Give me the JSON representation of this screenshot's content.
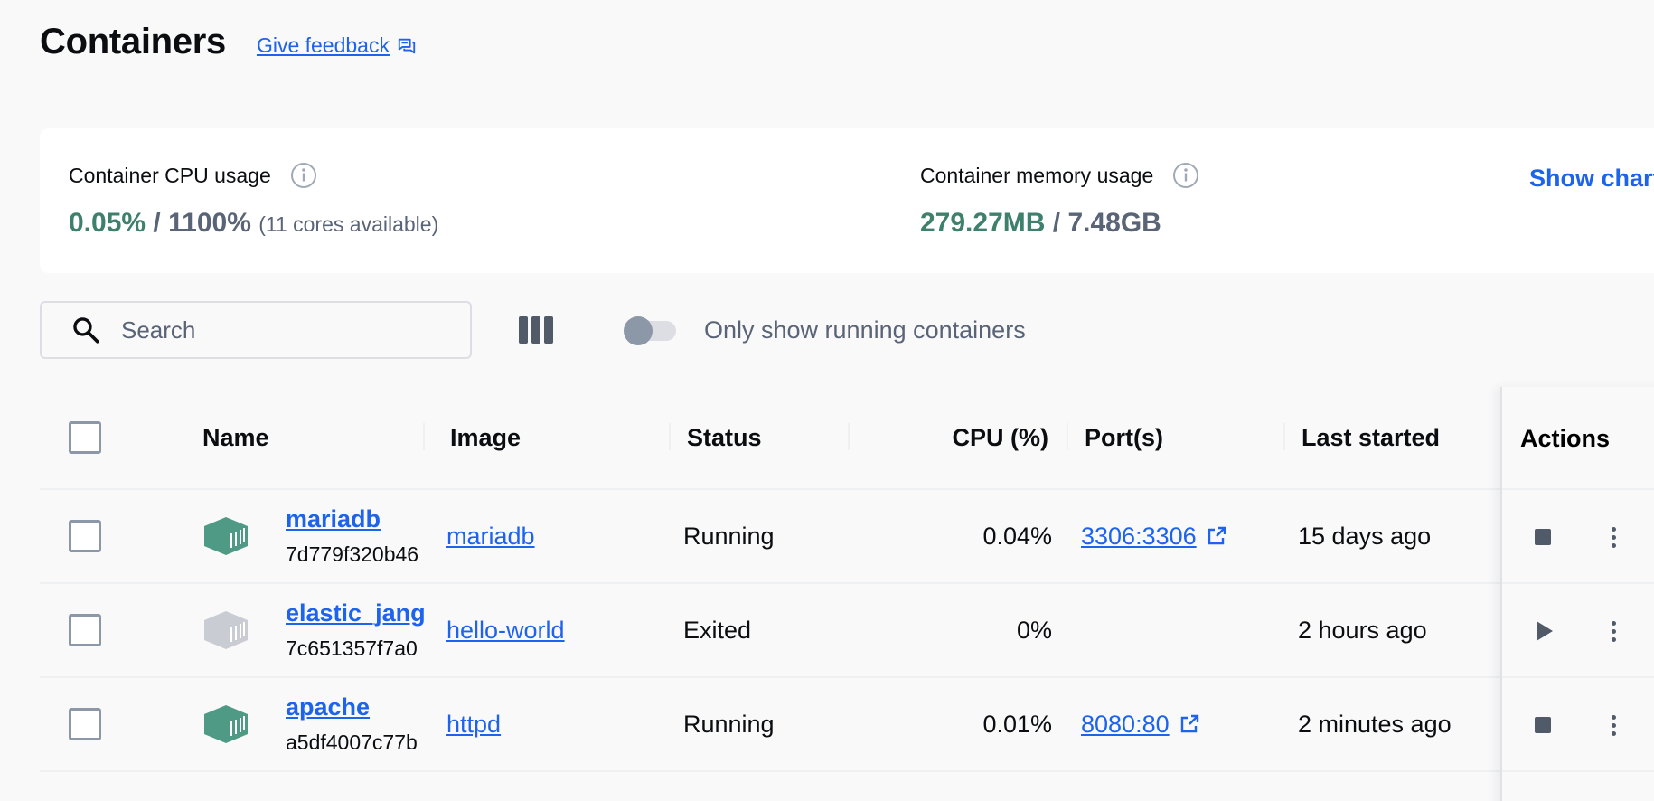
{
  "header": {
    "title": "Containers",
    "feedback_label": "Give feedback"
  },
  "stats": {
    "cpu": {
      "label": "Container CPU usage",
      "used": "0.05%",
      "separator": "/",
      "total": "1100%",
      "extra": "(11 cores available)"
    },
    "memory": {
      "label": "Container memory usage",
      "used": "279.27MB",
      "separator": "/",
      "total": "7.48GB"
    },
    "show_charts_label": "Show charts"
  },
  "toolbar": {
    "search_placeholder": "Search",
    "toggle_label": "Only show running containers"
  },
  "table": {
    "columns": [
      "Name",
      "Image",
      "Status",
      "CPU (%)",
      "Port(s)",
      "Last started",
      "Actions"
    ],
    "rows": [
      {
        "name": "mariadb",
        "id": "7d779f320b46",
        "image": "mariadb",
        "status": "Running",
        "cpu": "0.04%",
        "ports": "3306:3306",
        "last_started": "15 days ago"
      },
      {
        "name": "elastic_jang",
        "id": "7c651357f7a0",
        "image": "hello-world",
        "status": "Exited",
        "cpu": "0%",
        "ports": "",
        "last_started": "2 hours ago"
      },
      {
        "name": "apache",
        "id": "a5df4007c77b",
        "image": "httpd",
        "status": "Running",
        "cpu": "0.01%",
        "ports": "8080:80",
        "last_started": "2 minutes ago"
      }
    ]
  },
  "colors": {
    "running": "#4f9a85",
    "exited": "#c9ccd3",
    "link": "#1d63ed",
    "accent_value": "#3e806c"
  }
}
